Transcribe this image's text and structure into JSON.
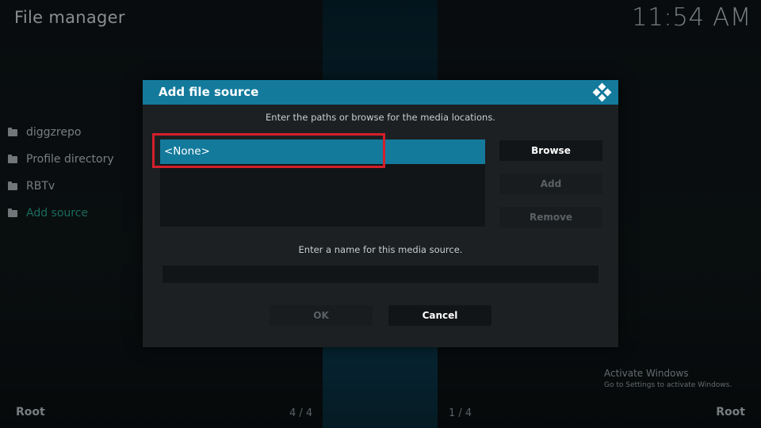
{
  "header": {
    "app_title": "File manager",
    "clock": "11:54 AM"
  },
  "sidebar": {
    "items": [
      {
        "label": "diggzrepo",
        "icon": "folder-icon"
      },
      {
        "label": "Profile directory",
        "icon": "folder-icon"
      },
      {
        "label": "RBTv",
        "icon": "folder-icon"
      },
      {
        "label": "Add source",
        "icon": "folder-icon"
      }
    ]
  },
  "footer": {
    "left_label": "Root",
    "right_label": "Root",
    "left_count": "4 / 4",
    "right_count": "1 / 4"
  },
  "watermark": {
    "title": "Activate Windows",
    "subtitle": "Go to Settings to activate Windows."
  },
  "dialog": {
    "title": "Add file source",
    "logo_icon": "kodi-logo-icon",
    "paths_instruction": "Enter the paths or browse for the media locations.",
    "paths": [
      "<None>"
    ],
    "browse_label": "Browse",
    "add_label": "Add",
    "remove_label": "Remove",
    "name_instruction": "Enter a name for this media source.",
    "name_value": "",
    "ok_label": "OK",
    "cancel_label": "Cancel"
  },
  "colors": {
    "accent": "#137a9c",
    "sidebar_accent": "#2aa38f",
    "highlight": "#d41f2b"
  }
}
